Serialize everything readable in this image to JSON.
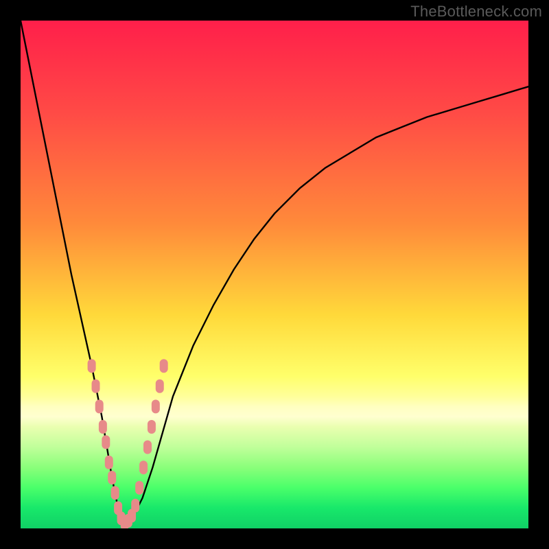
{
  "watermark": "TheBottleneck.com",
  "colors": {
    "frame": "#000000",
    "curve": "#000000",
    "marker": "#e78a89",
    "gradient_top": "#ff1f4a",
    "gradient_bottom": "#10d066"
  },
  "chart_data": {
    "type": "line",
    "title": "",
    "xlabel": "",
    "ylabel": "",
    "xlim": [
      0,
      100
    ],
    "ylim": [
      0,
      100
    ],
    "note": "Axes have no tick labels; x and y are 0–100 percent of plot width/height. y=0 is bottom edge, y=100 is top edge. The curve is a V-shaped bottleneck profile with its minimum at x≈20, with sparse pink rounded markers clustered near the minimum.",
    "series": [
      {
        "name": "bottleneck-curve",
        "x": [
          0,
          2,
          4,
          6,
          8,
          10,
          12,
          14,
          16,
          17,
          18,
          19,
          20,
          21,
          22,
          24,
          26,
          28,
          30,
          34,
          38,
          42,
          46,
          50,
          55,
          60,
          65,
          70,
          75,
          80,
          85,
          90,
          95,
          100
        ],
        "y": [
          100,
          90,
          80,
          70,
          60,
          50,
          41,
          32,
          22,
          16,
          10,
          5,
          2,
          1,
          2,
          6,
          12,
          19,
          26,
          36,
          44,
          51,
          57,
          62,
          67,
          71,
          74,
          77,
          79,
          81,
          82.5,
          84,
          85.5,
          87
        ]
      }
    ],
    "markers": {
      "note": "Rounded pink markers along the curve near the trough",
      "points": [
        {
          "x": 14.0,
          "y": 32
        },
        {
          "x": 14.8,
          "y": 28
        },
        {
          "x": 15.5,
          "y": 24
        },
        {
          "x": 16.2,
          "y": 20
        },
        {
          "x": 16.8,
          "y": 17
        },
        {
          "x": 17.4,
          "y": 13
        },
        {
          "x": 18.0,
          "y": 10
        },
        {
          "x": 18.6,
          "y": 7
        },
        {
          "x": 19.2,
          "y": 4
        },
        {
          "x": 19.8,
          "y": 2
        },
        {
          "x": 20.5,
          "y": 1
        },
        {
          "x": 21.2,
          "y": 1.5
        },
        {
          "x": 21.9,
          "y": 2.5
        },
        {
          "x": 22.6,
          "y": 4.5
        },
        {
          "x": 23.4,
          "y": 8
        },
        {
          "x": 24.2,
          "y": 12
        },
        {
          "x": 25.0,
          "y": 16
        },
        {
          "x": 25.8,
          "y": 20
        },
        {
          "x": 26.6,
          "y": 24
        },
        {
          "x": 27.4,
          "y": 28
        },
        {
          "x": 28.2,
          "y": 32
        }
      ]
    }
  }
}
